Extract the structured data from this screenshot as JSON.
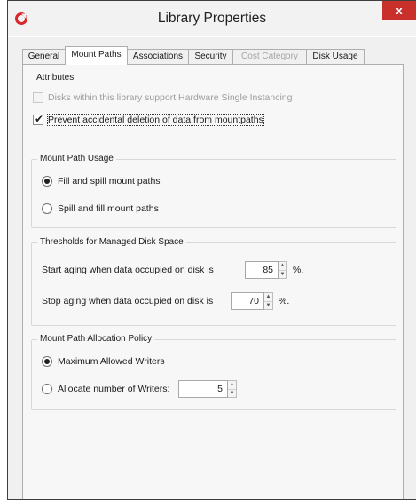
{
  "window": {
    "title": "Library Properties",
    "close_glyph": "x",
    "accent": "#c9302c"
  },
  "tabs": [
    {
      "label": "General"
    },
    {
      "label": "Mount Paths"
    },
    {
      "label": "Associations"
    },
    {
      "label": "Security"
    },
    {
      "label": "Cost Category"
    },
    {
      "label": "Disk Usage"
    }
  ],
  "active_tab": "Mount Paths",
  "attributes": {
    "title": "Attributes",
    "hardware_single_instancing": {
      "label": "Disks within this library support Hardware Single Instancing",
      "checked": false,
      "disabled": true
    },
    "prevent_deletion": {
      "label": "Prevent accidental deletion of data from mountpaths",
      "checked": true
    }
  },
  "mount_path_usage": {
    "title": "Mount Path Usage",
    "options": [
      {
        "label": "Fill and spill mount paths",
        "selected": true
      },
      {
        "label": "Spill and fill mount paths",
        "selected": false
      }
    ]
  },
  "thresholds": {
    "title": "Thresholds for Managed Disk Space",
    "start_aging": {
      "label": "Start aging when data occupied on disk is",
      "value": "85",
      "unit": "%."
    },
    "stop_aging": {
      "label": "Stop aging when data occupied on disk is",
      "value": "70",
      "unit": "%."
    }
  },
  "allocation_policy": {
    "title": "Mount Path Allocation Policy",
    "maximum_allowed": {
      "label": "Maximum Allowed Writers",
      "selected": true
    },
    "allocate_number": {
      "label": "Allocate number of Writers:",
      "selected": false,
      "value": "5"
    }
  },
  "icons": {
    "app": "app-logo-icon",
    "check": "✔",
    "spin_up": "▲",
    "spin_down": "▼"
  }
}
